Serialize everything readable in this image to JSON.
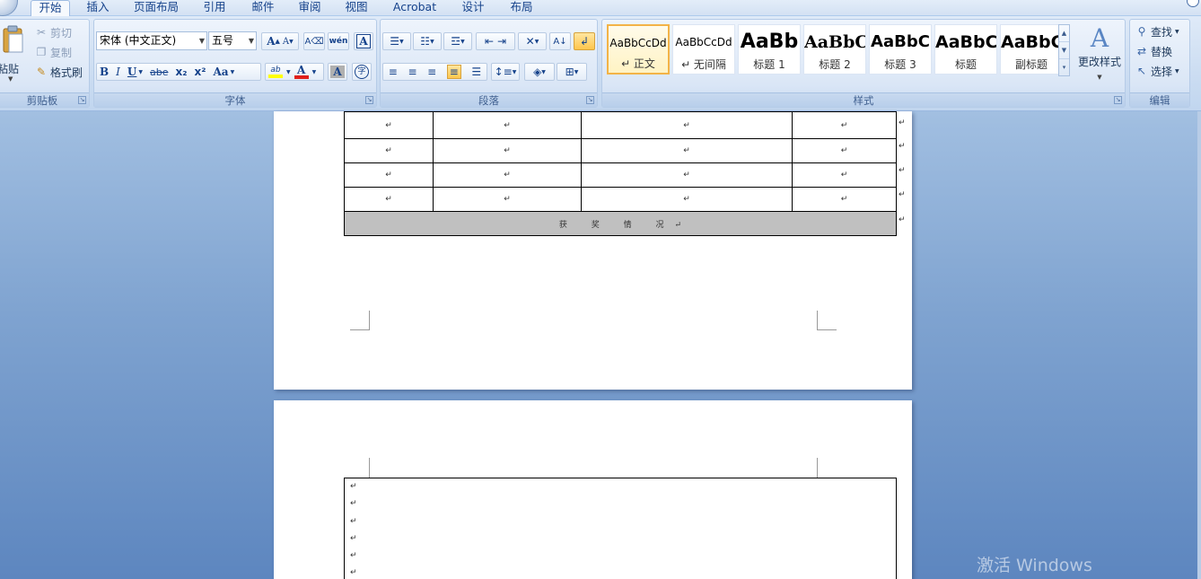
{
  "tabs": [
    {
      "label": "开始",
      "active": true
    },
    {
      "label": "插入"
    },
    {
      "label": "页面布局"
    },
    {
      "label": "引用"
    },
    {
      "label": "邮件"
    },
    {
      "label": "审阅"
    },
    {
      "label": "视图"
    },
    {
      "label": "Acrobat"
    },
    {
      "label": "设计"
    },
    {
      "label": "布局"
    }
  ],
  "clipboard": {
    "group_label": "剪贴板",
    "paste": "粘贴",
    "cut": "剪切",
    "copy": "复制",
    "format_painter": "格式刷"
  },
  "font": {
    "group_label": "字体",
    "font_name": "宋体 (中文正文)",
    "font_size": "五号",
    "grow": "A",
    "shrink": "A",
    "phonetic": "wén",
    "bold": "B",
    "italic": "I",
    "underline": "U",
    "strike": "abe",
    "subscript": "x₂",
    "superscript": "x²",
    "change_case": "Aa",
    "highlight": "ab",
    "font_color": "A",
    "char_shading": "A",
    "enclose": "字"
  },
  "paragraph": {
    "group_label": "段落"
  },
  "styles": {
    "group_label": "样式",
    "items": [
      {
        "sample": "AaBbCcDd",
        "name": "↵ 正文",
        "active": true
      },
      {
        "sample": "AaBbCcDd",
        "name": "↵ 无间隔"
      },
      {
        "sample": "AaBb",
        "name": "标题 1"
      },
      {
        "sample": "AaBbC",
        "name": "标题 2"
      },
      {
        "sample": "AaBbC",
        "name": "标题 3"
      },
      {
        "sample": "AaBbC",
        "name": "标题"
      },
      {
        "sample": "AaBbC",
        "name": "副标题"
      }
    ],
    "change_styles": "更改样式"
  },
  "editing": {
    "group_label": "编辑",
    "find": "查找",
    "replace": "替换",
    "select": "选择"
  },
  "document": {
    "paragraph_mark": "↵",
    "award_title": "获 奖 情 况",
    "table_rows": 4,
    "box_lines": 6
  },
  "watermark": "激活 Windows",
  "colors": {
    "accent": "#f3b347",
    "tab_text": "#15428b",
    "award_bg": "#c0c0c0"
  }
}
